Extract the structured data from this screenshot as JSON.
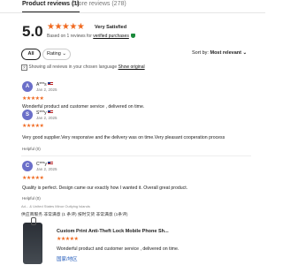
{
  "tabs": [
    {
      "label": "Product reviews (1)",
      "active": true
    },
    {
      "label": "Store reviews (278)",
      "active": false
    }
  ],
  "summary": {
    "score": "5.0",
    "stars": "★★★★★",
    "verdict": "Very Satisfied",
    "based_on_prefix": "Based on 1 reviews for",
    "verified_label": "verified purchases"
  },
  "filters": {
    "all_label": "All",
    "rating_label": "Rating ⌄",
    "sort_prefix": "Sort by:",
    "sort_value": "Most relevant ⌄"
  },
  "language_note": {
    "prefix": "Showing all reviews in your chosen language",
    "link": "Show original"
  },
  "reviews": [
    {
      "initial": "A",
      "name": "A***s",
      "date": "Jan 2, 2025",
      "stars": "★★★★★",
      "text": "Wonderful product and customer service , delivered on time.",
      "helpful": ""
    },
    {
      "initial": "S",
      "name": "S***y",
      "date": "Jan 2, 2025",
      "stars": "★★★★★",
      "text": "Very good supplier.Very responsive and the delivery was on time.Very pleasant cooperation process",
      "helpful": "Helpful (0)"
    },
    {
      "initial": "C",
      "name": "C***y",
      "date": "Jan 2, 2025",
      "stars": "★★★★★",
      "text": "Quality is perfect. Design came our exactly how I wanted it. Overall great product.",
      "helpful": "Helpful (0)"
    }
  ],
  "disclaimer": "Ad... & United States Minor Outlying Islands",
  "properties": "供应商服务  非常满意 (1 条评)        按时交货  非常满意 (1条评)",
  "product": {
    "title": "Custom Print Anti-Theft Lock Mobile Phone Sh...",
    "stars": "★★★★★",
    "review_text": "Wonderful product and customer service , delivered on time.",
    "link": "国家/地区"
  },
  "colors": {
    "accent": "#f06a21",
    "avatar": "#6b6fc9",
    "verified": "#1b8a3b"
  }
}
